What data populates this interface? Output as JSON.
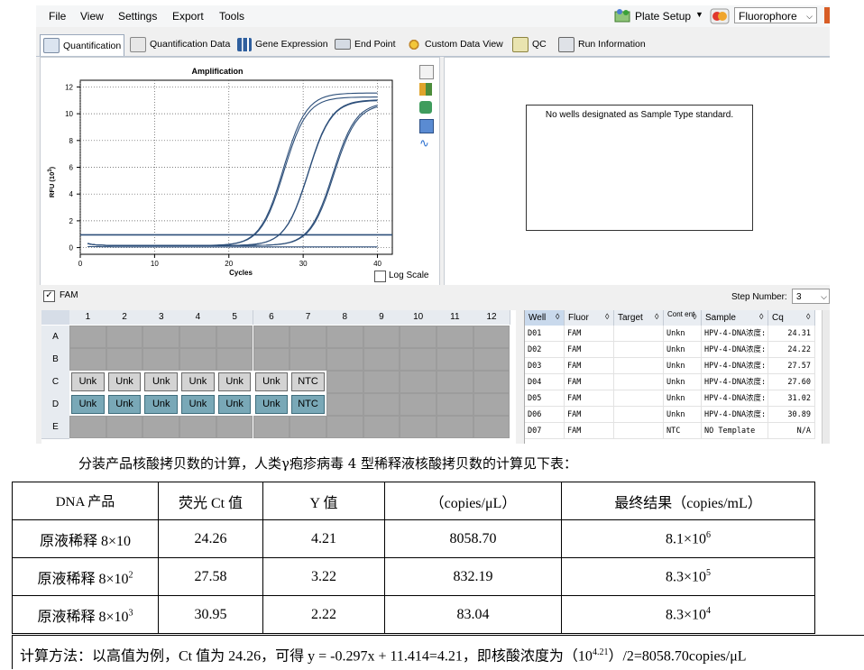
{
  "menu": {
    "file": "File",
    "view": "View",
    "settings": "Settings",
    "export": "Export",
    "tools": "Tools"
  },
  "toolbar": {
    "plate_setup": "Plate Setup",
    "fluorophore": "Fluorophore"
  },
  "tabs": [
    "Quantification",
    "Quantification Data",
    "Gene Expression",
    "End Point",
    "Custom Data View",
    "QC",
    "Run Information"
  ],
  "colors": {
    "curve": "#2d4f7a",
    "selected_well": "#79a8b7",
    "empty_well": "#a7a7a7"
  },
  "chart_data": {
    "type": "line",
    "title": "Amplification",
    "xlabel": "Cycles",
    "ylabel": "RFU (10^3)",
    "xlim": [
      0,
      42
    ],
    "ylim": [
      -0.5,
      12.5
    ],
    "xticks": [
      0,
      10,
      20,
      30,
      40
    ],
    "yticks": [
      0,
      2,
      4,
      6,
      8,
      10,
      12
    ],
    "grid": true,
    "threshold": 0.95,
    "series": [
      {
        "cq": 24.22,
        "plateau": 11.4
      },
      {
        "cq": 24.31,
        "plateau": 11.1
      },
      {
        "cq": 27.57,
        "plateau": 10.9
      },
      {
        "cq": 27.6,
        "plateau": 10.85
      },
      {
        "cq": 30.89,
        "plateau": 10.7
      },
      {
        "cq": 31.02,
        "plateau": 10.6
      },
      {
        "cq": null,
        "plateau": 0.05
      }
    ]
  },
  "chart_controls": {
    "log_scale": "Log Scale"
  },
  "right_panel": {
    "message": "No wells designated as Sample Type standard."
  },
  "fam_bar": {
    "fam": "FAM",
    "step_label": "Step Number:",
    "step_value": "3"
  },
  "plate": {
    "columns": [
      "1",
      "2",
      "3",
      "4",
      "5",
      "6",
      "7",
      "8",
      "9",
      "10",
      "11",
      "12"
    ],
    "rows": [
      "A",
      "B",
      "C",
      "D",
      "E"
    ],
    "row_c": [
      "Unk",
      "Unk",
      "Unk",
      "Unk",
      "Unk",
      "Unk",
      "NTC"
    ],
    "row_d": [
      "Unk",
      "Unk",
      "Unk",
      "Unk",
      "Unk",
      "Unk",
      "NTC"
    ]
  },
  "grid_table": {
    "headers": [
      "Well",
      "Fluor",
      "Target",
      "Cont ent",
      "Sample",
      "Cq"
    ],
    "rows": [
      [
        "D01",
        "FAM",
        "",
        "Unkn",
        "HPV-4-DNA浓度:",
        "24.31"
      ],
      [
        "D02",
        "FAM",
        "",
        "Unkn",
        "HPV-4-DNA浓度:",
        "24.22"
      ],
      [
        "D03",
        "FAM",
        "",
        "Unkn",
        "HPV-4-DNA浓度:",
        "27.57"
      ],
      [
        "D04",
        "FAM",
        "",
        "Unkn",
        "HPV-4-DNA浓度:",
        "27.60"
      ],
      [
        "D05",
        "FAM",
        "",
        "Unkn",
        "HPV-4-DNA浓度:",
        "31.02"
      ],
      [
        "D06",
        "FAM",
        "",
        "Unkn",
        "HPV-4-DNA浓度:",
        "30.89"
      ],
      [
        "D07",
        "FAM",
        "",
        "NTC",
        "NO Template",
        "N/A"
      ]
    ]
  },
  "doc": {
    "caption": "分装产品核酸拷贝数的计算，人类γ疱疹病毒 4 型稀释液核酸拷贝数的计算见下表：",
    "table_headers": [
      "DNA 产品",
      "荧光 Ct 值",
      "Y 值",
      "（copies/μL）",
      "最终结果（copies/mL）"
    ],
    "rows": [
      {
        "product": "原液稀释 8×10",
        "ct": "24.26",
        "y": "4.21",
        "copies": "8058.70",
        "result_base": "8.1×10",
        "result_exp": "6"
      },
      {
        "product": "原液稀释 8×10",
        "product_exp": "2",
        "ct": "27.58",
        "y": "3.22",
        "copies": "832.19",
        "result_base": "8.3×10",
        "result_exp": "5"
      },
      {
        "product": "原液稀释 8×10",
        "product_exp": "3",
        "ct": "30.95",
        "y": "2.22",
        "copies": "83.04",
        "result_base": "8.3×10",
        "result_exp": "4"
      }
    ],
    "note_pre": "计算方法：以高值为例，Ct 值为 24.26，可得 y = -0.297x + 11.414=4.21，即核酸浓度为（10",
    "note_exp": "4.21",
    "note_post": "）/2=8058.70copies/μL"
  }
}
